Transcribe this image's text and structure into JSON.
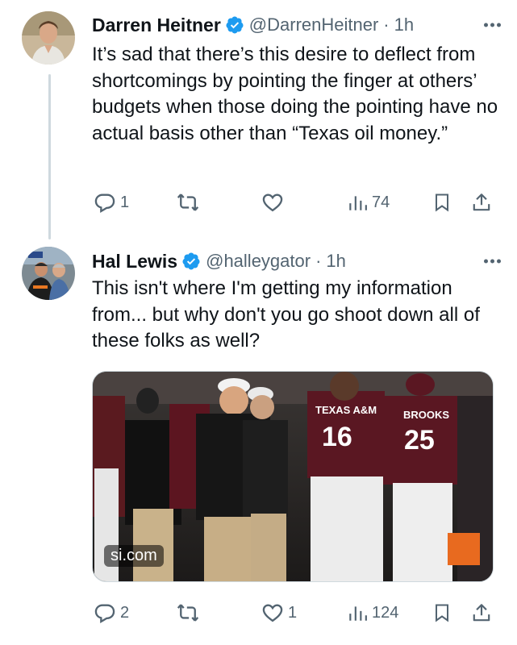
{
  "tweets": [
    {
      "name": "Darren Heitner",
      "handle": "@DarrenHeitner",
      "separator": "·",
      "time": "1h",
      "text": "It’s sad that there’s this desire to deflect from shortcomings by pointing the finger at others’ budgets when those doing the pointing have no actual basis other than “Texas oil money.”",
      "replies": "1",
      "retweets": "",
      "likes": "",
      "views": "74"
    },
    {
      "name": "Hal Lewis",
      "handle": "@halleygator",
      "separator": "·",
      "time": "1h",
      "text": "This isn't where I'm getting my information from... but why don't you go shoot down all of these folks as well?",
      "media_source": "si.com",
      "jersey_left": "TEXAS A&M 16",
      "jersey_right": "BROOKS 25",
      "replies": "2",
      "retweets": "",
      "likes": "1",
      "views": "124"
    }
  ],
  "colors": {
    "verified": "#1d9bf0",
    "icon": "#536471",
    "maroon": "#500000"
  },
  "icons": [
    "reply-icon",
    "retweet-icon",
    "like-icon",
    "views-icon",
    "bookmark-icon",
    "share-icon",
    "verified-badge-icon",
    "more-icon"
  ]
}
